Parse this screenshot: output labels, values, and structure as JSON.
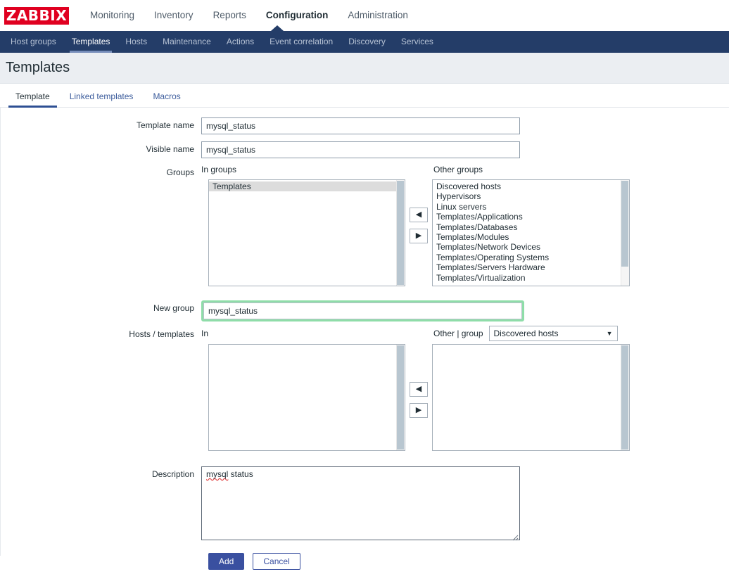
{
  "brand": {
    "logo_text": "ZABBIX",
    "logo_bg": "#e00020"
  },
  "topnav": {
    "items": [
      {
        "label": "Monitoring",
        "selected": false
      },
      {
        "label": "Inventory",
        "selected": false
      },
      {
        "label": "Reports",
        "selected": false
      },
      {
        "label": "Configuration",
        "selected": true
      },
      {
        "label": "Administration",
        "selected": false
      }
    ]
  },
  "subnav": {
    "bg": "#243d68",
    "items": [
      {
        "label": "Host groups",
        "selected": false
      },
      {
        "label": "Templates",
        "selected": true
      },
      {
        "label": "Hosts",
        "selected": false
      },
      {
        "label": "Maintenance",
        "selected": false
      },
      {
        "label": "Actions",
        "selected": false
      },
      {
        "label": "Event correlation",
        "selected": false
      },
      {
        "label": "Discovery",
        "selected": false
      },
      {
        "label": "Services",
        "selected": false
      }
    ]
  },
  "page": {
    "title": "Templates"
  },
  "tabs": [
    {
      "label": "Template",
      "selected": true
    },
    {
      "label": "Linked templates",
      "selected": false
    },
    {
      "label": "Macros",
      "selected": false
    }
  ],
  "form": {
    "template_name": {
      "label": "Template name",
      "value": "mysql_status"
    },
    "visible_name": {
      "label": "Visible name",
      "value": "mysql_status"
    },
    "groups": {
      "label": "Groups",
      "in_label": "In groups",
      "other_label": "Other groups",
      "in_items": [
        "Templates"
      ],
      "in_selected_index": 0,
      "other_items": [
        "Discovered hosts",
        "Hypervisors",
        "Linux servers",
        "Templates/Applications",
        "Templates/Databases",
        "Templates/Modules",
        "Templates/Network Devices",
        "Templates/Operating Systems",
        "Templates/Servers Hardware",
        "Templates/Virtualization"
      ],
      "move_left_glyph": "◀",
      "move_right_glyph": "▶"
    },
    "new_group": {
      "label": "New group",
      "value": "mysql_status",
      "focus_ring_color": "#8fdda9"
    },
    "hosts_templates": {
      "label": "Hosts / templates",
      "in_label": "In",
      "other_label": "Other | group",
      "group_select_value": "Discovered hosts",
      "in_items": [],
      "other_items": [],
      "move_left_glyph": "◀",
      "move_right_glyph": "▶",
      "caret_glyph": "▼"
    },
    "description": {
      "label": "Description",
      "value": "mysql status",
      "spellcheck_word": "mysql",
      "rest_text": " status"
    }
  },
  "actions": {
    "add_label": "Add",
    "cancel_label": "Cancel",
    "primary_color": "#3a50a0"
  }
}
